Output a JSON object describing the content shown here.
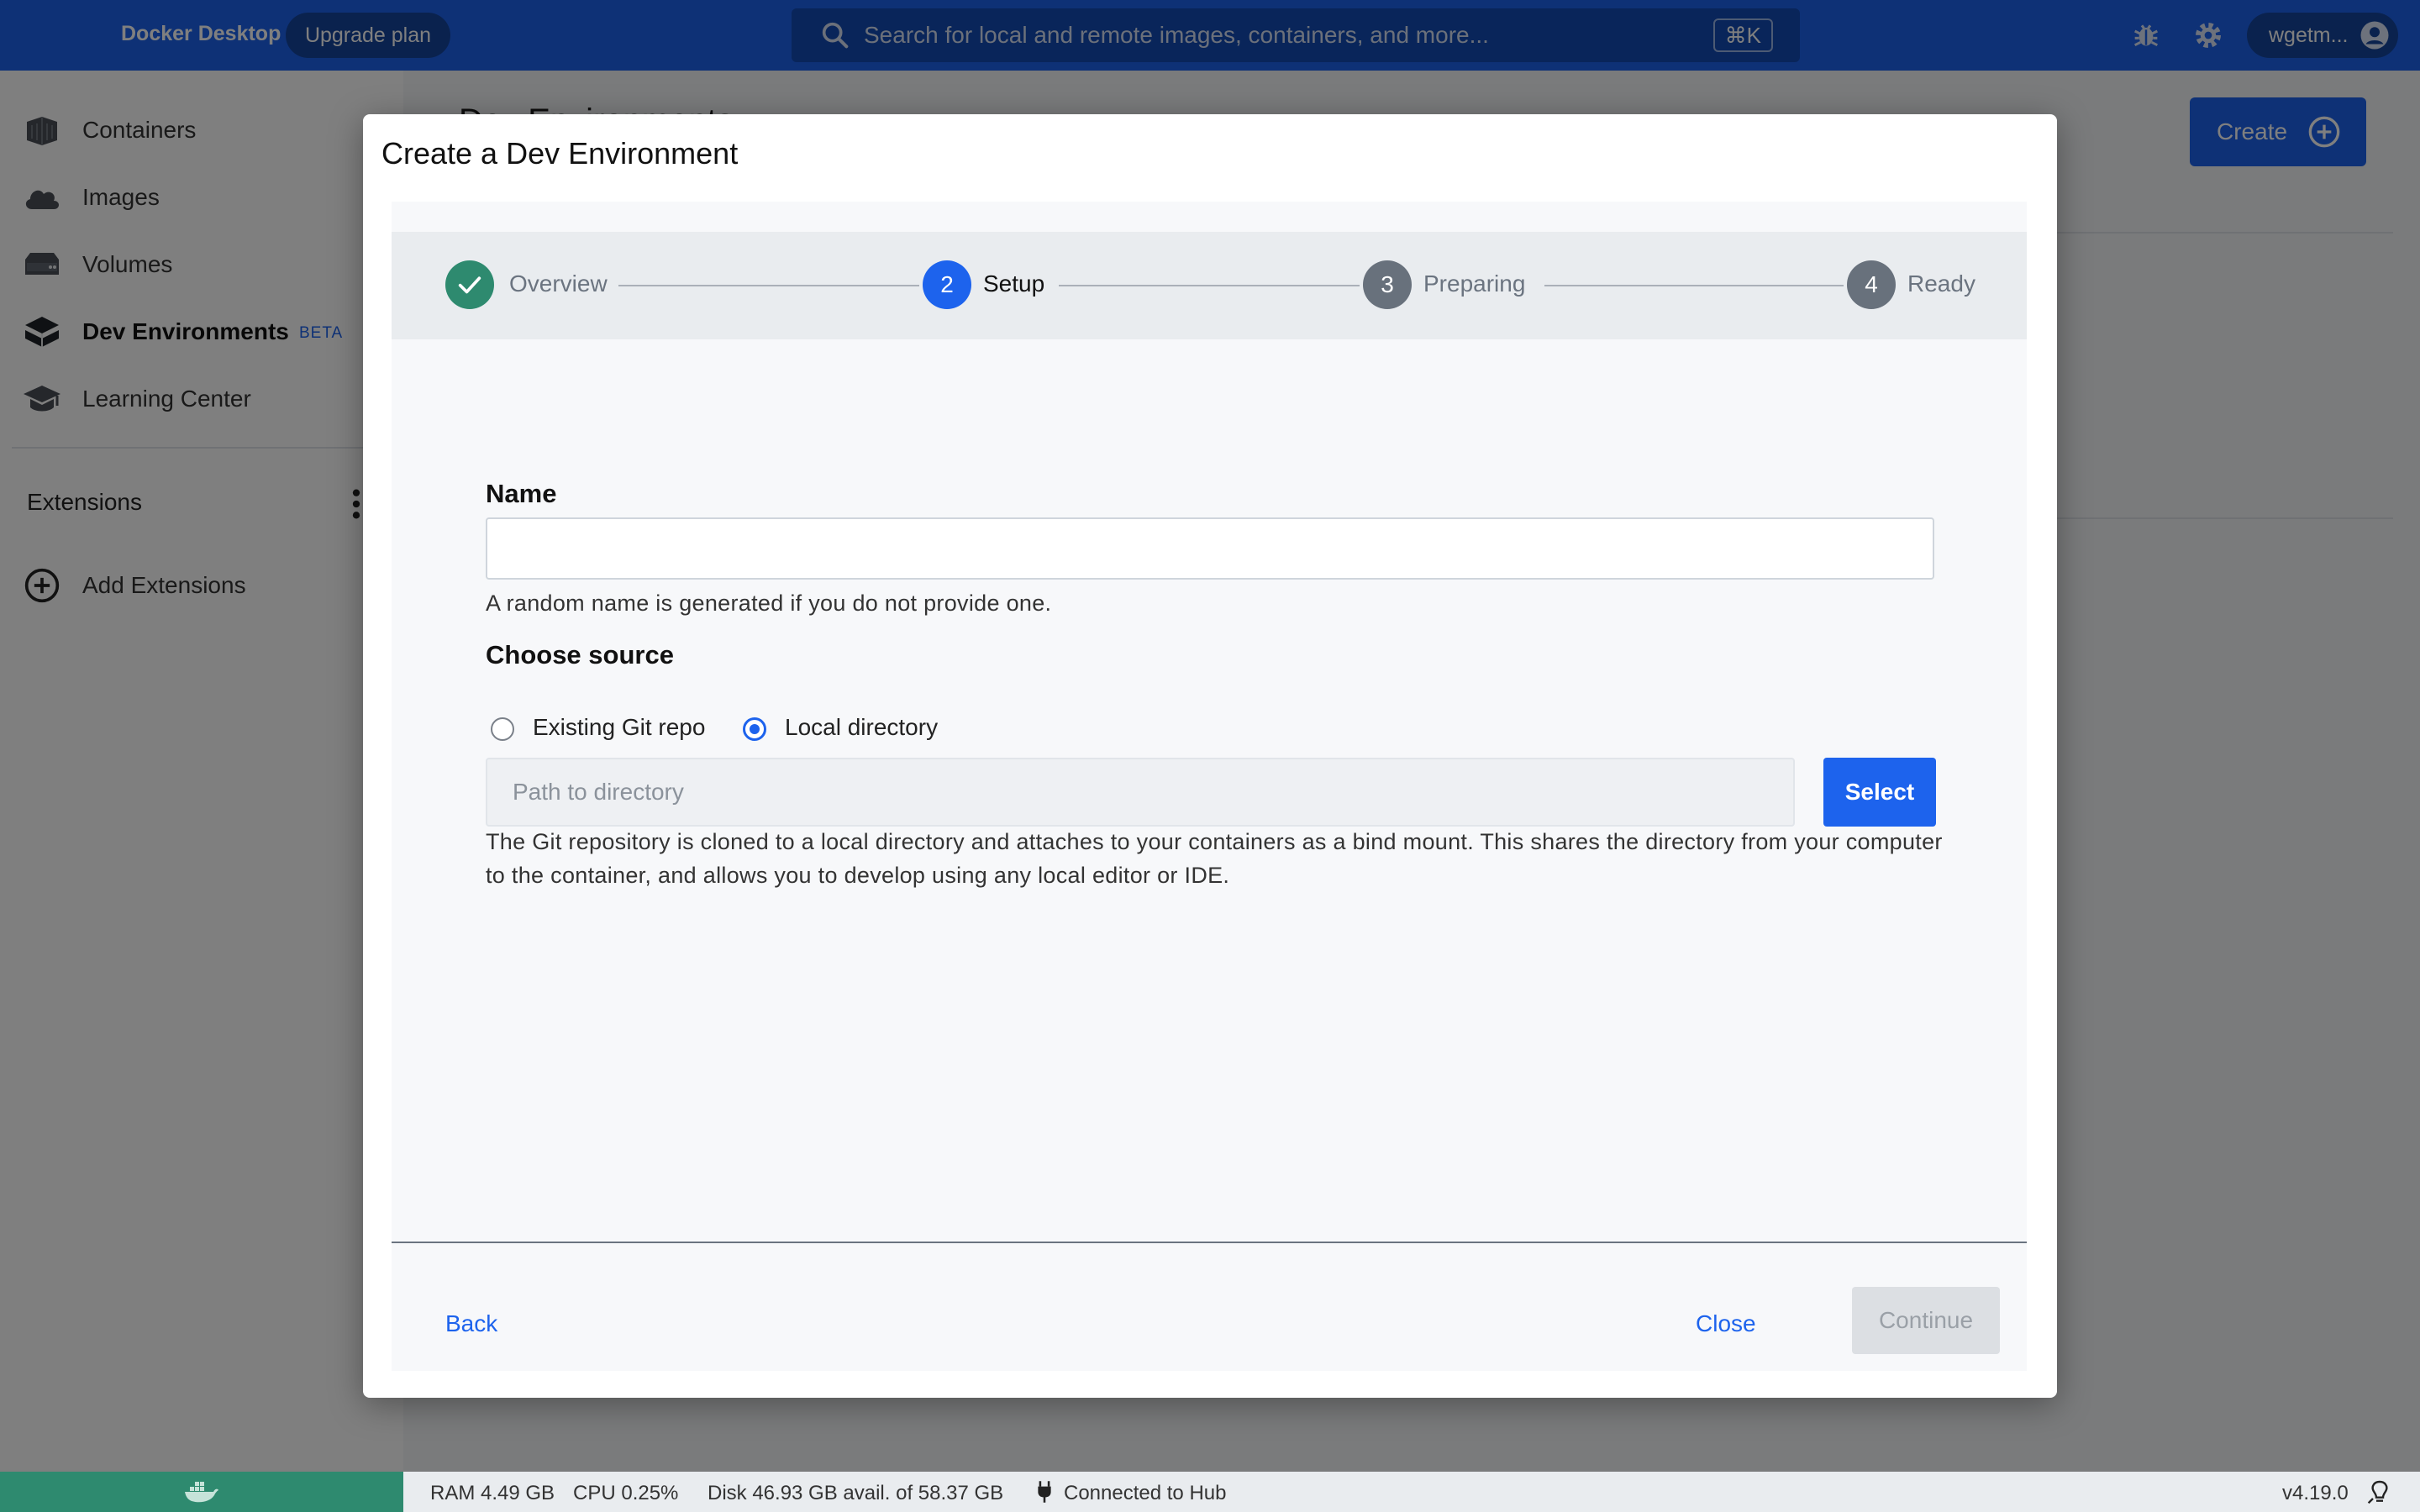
{
  "app": {
    "brand": "Docker Desktop",
    "upgrade_label": "Upgrade plan",
    "accent_color": "#1d63ed"
  },
  "search": {
    "placeholder": "Search for local and remote images, containers, and more...",
    "shortcut": "⌘K",
    "icon": "search-icon"
  },
  "topbar": {
    "icons": [
      "bug-icon",
      "gear-icon"
    ],
    "user": "wgetm..."
  },
  "sidebar": {
    "items": [
      {
        "label": "Containers",
        "icon": "containers-icon"
      },
      {
        "label": "Images",
        "icon": "images-cloud-icon"
      },
      {
        "label": "Volumes",
        "icon": "volumes-icon"
      },
      {
        "label": "Dev Environments",
        "icon": "dev-environments-icon",
        "badge": "BETA",
        "active": true
      },
      {
        "label": "Learning Center",
        "icon": "learning-center-icon"
      }
    ],
    "extensions_title": "Extensions",
    "add_extensions": "Add Extensions"
  },
  "main": {
    "title": "Dev Environments",
    "create_label": "Create"
  },
  "dialog": {
    "title": "Create a Dev Environment",
    "steps": [
      {
        "number": "✓",
        "label": "Overview",
        "state": "done"
      },
      {
        "number": "2",
        "label": "Setup",
        "state": "current"
      },
      {
        "number": "3",
        "label": "Preparing",
        "state": "pending"
      },
      {
        "number": "4",
        "label": "Ready",
        "state": "pending"
      }
    ],
    "name_label": "Name",
    "name_value": "",
    "name_helper": "A random name is generated if you do not provide one.",
    "source_label": "Choose source",
    "source_options": [
      {
        "label": "Existing Git repo",
        "checked": false
      },
      {
        "label": "Local directory",
        "checked": true
      }
    ],
    "path_placeholder": "Path to directory",
    "select_label": "Select",
    "source_helper": "The Git repository is cloned to a local directory and attaches to your containers as a bind mount. This shares the directory from your computer to the container, and allows you to develop using any local editor or IDE.",
    "back_label": "Back",
    "close_label": "Close",
    "continue_label": "Continue"
  },
  "status": {
    "ram": "RAM 4.49 GB",
    "cpu": "CPU 0.25%",
    "disk": "Disk 46.93 GB avail. of 58.37 GB",
    "hub": "Connected to Hub",
    "version": "v4.19.0"
  }
}
